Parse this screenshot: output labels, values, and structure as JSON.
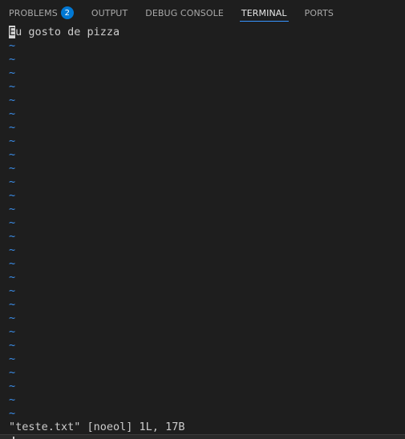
{
  "tabs": [
    {
      "label": "PROBLEMS",
      "badge": "2",
      "active": false
    },
    {
      "label": "OUTPUT",
      "active": false
    },
    {
      "label": "DEBUG CONSOLE",
      "active": false
    },
    {
      "label": "TERMINAL",
      "active": true
    },
    {
      "label": "PORTS",
      "active": false
    }
  ],
  "terminal": {
    "cursor_char": "E",
    "first_line_rest": "u gosto de pizza",
    "tilde": "~",
    "tilde_count": 28,
    "status_line": "\"teste.txt\" [noeol] 1L, 17B"
  },
  "colors": {
    "background": "#1e1e1e",
    "tilde": "#3b8eea",
    "active_tab_underline": "#3794ff",
    "badge": "#0078d4"
  }
}
